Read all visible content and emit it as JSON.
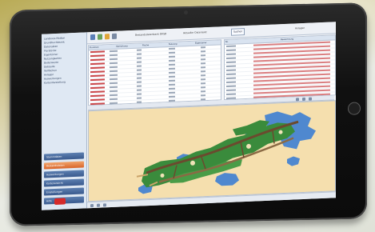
{
  "scene": {
    "background": "#d8d0a4",
    "tablet_color": "#111111"
  },
  "app": {
    "window_title": "Bestandsdatenbank DKSB",
    "record_label": "Aktueller Datensatz",
    "toolbar_button": "Suchen",
    "right_panel_title": "Anlagen"
  },
  "sidebar": {
    "items": [
      "Landkreis Meißen",
      "Grundbuchbezirk",
      "Datensätze",
      "Flurstücke",
      "Eigentümer",
      "Nutzungsarten",
      "Bodenwerte",
      "Gebäude",
      "Teilflächen",
      "Anlagen",
      "Auswertungen",
      "Kartendarstellung"
    ],
    "buttons": [
      {
        "label": "Stammdaten",
        "active": false
      },
      {
        "label": "Bestandsdaten",
        "active": true
      },
      {
        "label": "Auswertungen",
        "active": false
      },
      {
        "label": "Kartenansicht",
        "active": false
      },
      {
        "label": "Einstellungen",
        "active": false
      },
      {
        "label": "Hilfe",
        "active": false
      }
    ],
    "exit_label": "Ende"
  },
  "left_table": {
    "columns": [
      "Flurstück",
      "Gemarkung",
      "Fläche",
      "Nutzung",
      "Eigentümer"
    ],
    "row_count": 16
  },
  "right_table": {
    "columns": [
      "Nr.",
      "Bezeichnung"
    ],
    "row_count": 14
  },
  "map": {
    "water_color": "#4f88cf",
    "land_color": "#f5dfae",
    "forest_color": "#3a8b3c",
    "road_color": "#6b4a2e"
  },
  "icons": [
    "home-icon",
    "back-icon",
    "forward-icon",
    "save-icon",
    "search-icon",
    "print-icon",
    "zoom-in-icon",
    "zoom-out-icon",
    "stop-icon"
  ]
}
